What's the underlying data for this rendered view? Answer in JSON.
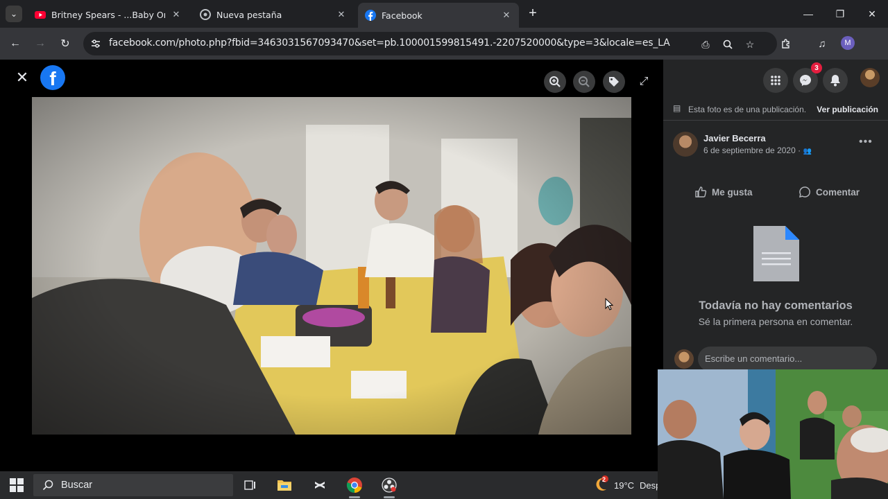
{
  "browser": {
    "tabs": [
      {
        "title": "Britney Spears - ...Baby One Mo",
        "icon": "youtube-icon",
        "active": false
      },
      {
        "title": "Nueva pestaña",
        "icon": "chrome-icon",
        "active": false
      },
      {
        "title": "Facebook",
        "icon": "facebook-icon",
        "active": true
      }
    ],
    "url": "facebook.com/photo.php?fbid=3463031567093470&set=pb.100001599815491.-2207520000&type=3&locale=es_LA",
    "profile_initial": "M"
  },
  "viewer": {
    "close_label": "✕",
    "logo_letter": "f"
  },
  "panel": {
    "messenger_badge": "3",
    "post_note": "Esta foto es de una publicación.",
    "view_post": "Ver publicación",
    "author": "Javier Becerra",
    "date": "6 de septiembre de 2020 ·",
    "like": "Me gusta",
    "comment": "Comentar",
    "empty_title": "Todavía no hay comentarios",
    "empty_sub": "Sé la primera persona en comentar.",
    "comment_placeholder": "Escribe un comentario..."
  },
  "taskbar": {
    "search_label": "Buscar",
    "weather_badge": "2",
    "temperature": "19°C",
    "weather_text": "Despejado"
  },
  "colors": {
    "facebook_blue": "#1877f2",
    "panel_bg": "#242526",
    "chrome_dark": "#202124"
  }
}
